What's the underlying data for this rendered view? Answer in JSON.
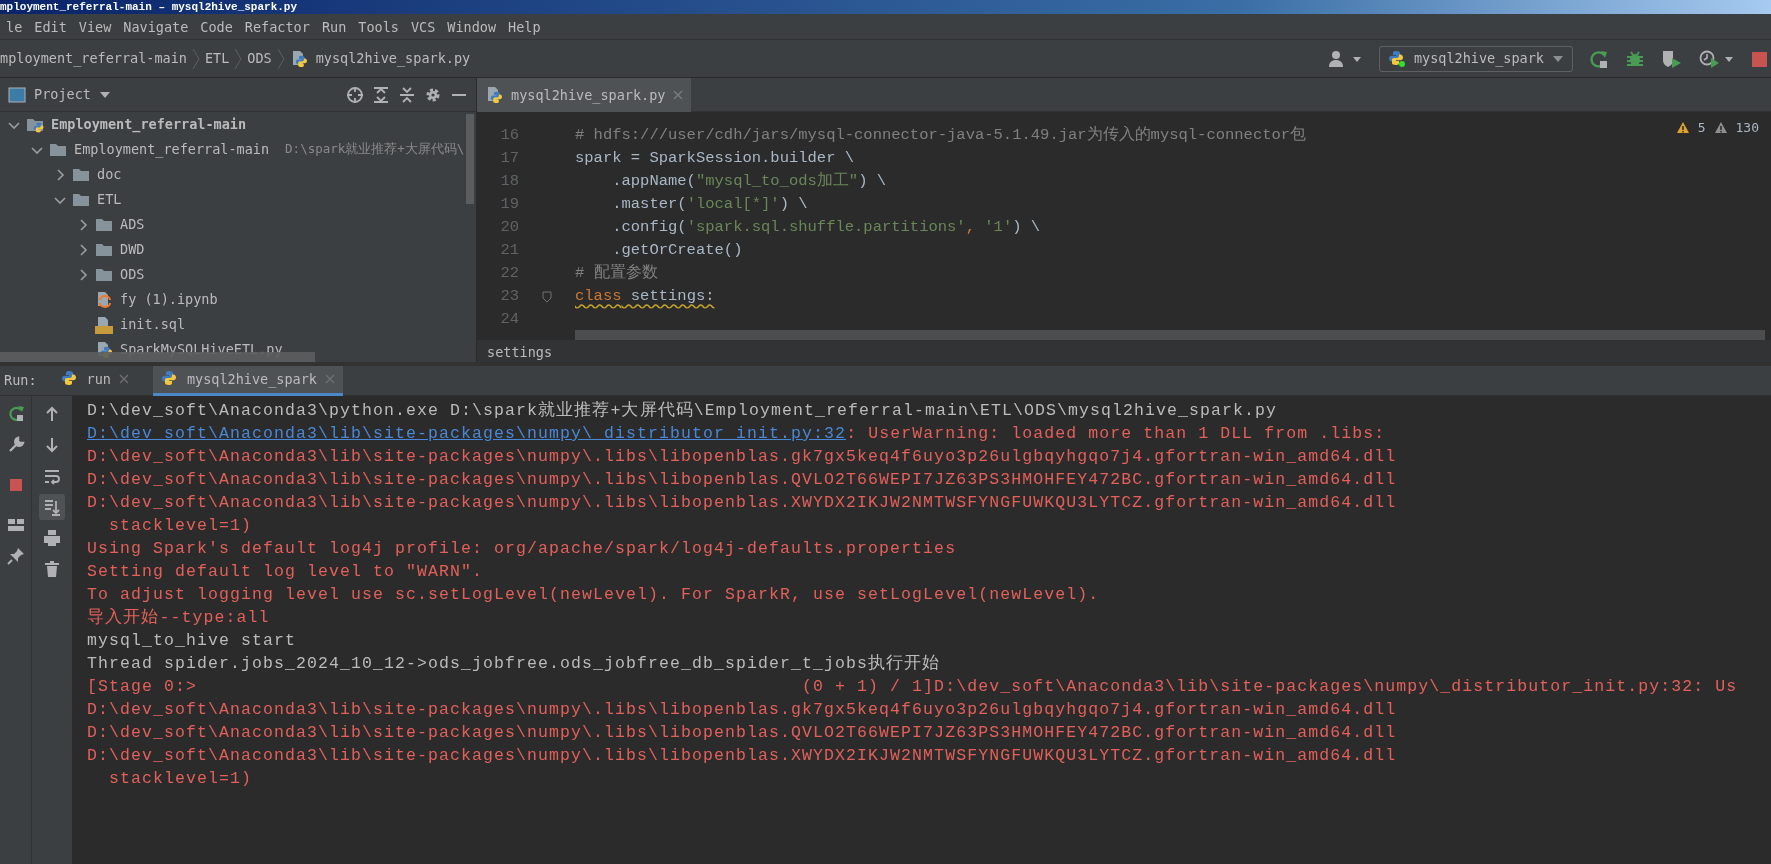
{
  "window": {
    "title": "mployment_referral-main – mysql2hive_spark.py"
  },
  "menu": [
    "le",
    "Edit",
    "View",
    "Navigate",
    "Code",
    "Refactor",
    "Run",
    "Tools",
    "VCS",
    "Window",
    "Help"
  ],
  "breadcrumbs": [
    {
      "label": "mployment_referral-main",
      "kind": "project"
    },
    {
      "label": "ETL",
      "kind": "folder"
    },
    {
      "label": "ODS",
      "kind": "folder"
    },
    {
      "label": "mysql2hive_spark.py",
      "kind": "python"
    }
  ],
  "run_config": {
    "label": "mysql2hive_spark"
  },
  "project_panel": {
    "title": "Project",
    "tree": [
      {
        "label": "Employment_referral-main",
        "kind": "project",
        "expanded": true,
        "children": [
          {
            "label": "Employment_referral-main",
            "kind": "folder",
            "expanded": true,
            "path": "D:\\spark就业推荐+大屏代码\\",
            "children": [
              {
                "label": "doc",
                "kind": "folder",
                "expanded": false
              },
              {
                "label": "ETL",
                "kind": "folder",
                "expanded": true,
                "children": [
                  {
                    "label": "ADS",
                    "kind": "folder",
                    "expanded": false
                  },
                  {
                    "label": "DWD",
                    "kind": "folder",
                    "expanded": false
                  },
                  {
                    "label": "ODS",
                    "kind": "folder",
                    "expanded": false
                  },
                  {
                    "label": "fy (1).ipynb",
                    "kind": "notebook"
                  },
                  {
                    "label": "init.sql",
                    "kind": "sql"
                  },
                  {
                    "label": "SparkMySQLHiveETL.py",
                    "kind": "python"
                  }
                ]
              }
            ]
          }
        ]
      }
    ]
  },
  "editor": {
    "tabs": [
      {
        "label": "mysql2hive_spark.py",
        "selected": true
      }
    ],
    "inspections": [
      {
        "kind": "warning",
        "count": "5"
      },
      {
        "kind": "weak_warning",
        "count": "130"
      }
    ],
    "lines": [
      {
        "number": "16",
        "tokens": [
          {
            "kind": "comment",
            "text": "# hdfs:///user/cdh/jars/mysql-connector-java-5.1.49.jar为传入的mysql-connector包"
          }
        ]
      },
      {
        "number": "17",
        "tokens": [
          {
            "kind": "plain",
            "text": "spark = SparkSession.builder \\"
          }
        ]
      },
      {
        "number": "18",
        "tokens": [
          {
            "kind": "plain",
            "text": "    .appName("
          },
          {
            "kind": "string",
            "text": "\"mysql_to_ods加工\""
          },
          {
            "kind": "plain",
            "text": ") \\"
          }
        ]
      },
      {
        "number": "19",
        "tokens": [
          {
            "kind": "plain",
            "text": "    .master("
          },
          {
            "kind": "string",
            "text": "'local[*]'"
          },
          {
            "kind": "plain",
            "text": ") \\"
          }
        ]
      },
      {
        "number": "20",
        "tokens": [
          {
            "kind": "plain",
            "text": "    .config("
          },
          {
            "kind": "string",
            "text": "'spark.sql.shuffle.partitions'"
          },
          {
            "kind": "keyword",
            "text": ", "
          },
          {
            "kind": "string",
            "text": "'1'"
          },
          {
            "kind": "plain",
            "text": ") \\"
          }
        ]
      },
      {
        "number": "21",
        "tokens": [
          {
            "kind": "plain",
            "text": "    .getOrCreate()"
          }
        ]
      },
      {
        "number": "22",
        "tokens": [
          {
            "kind": "comment",
            "text": "# 配置参数"
          }
        ]
      },
      {
        "number": "23",
        "flagged": true,
        "tokens": [
          {
            "kind": "keyword",
            "text": "class"
          },
          {
            "kind": "plain",
            "text": " settings:"
          }
        ]
      },
      {
        "number": "24"
      }
    ],
    "breadcrumb": "settings"
  },
  "run_panel": {
    "label": "Run:",
    "tabs": [
      {
        "label": "run",
        "selected": false
      },
      {
        "label": "mysql2hive_spark",
        "selected": true
      }
    ],
    "console": [
      {
        "kind": "plain",
        "text": "D:\\dev_soft\\Anaconda3\\python.exe D:\\spark就业推荐+大屏代码\\Employment_referral-main\\ETL\\ODS\\mysql2hive_spark.py"
      },
      {
        "kind": "link",
        "link": "D:\\dev_soft\\Anaconda3\\lib\\site-packages\\numpy\\_distributor_init.py:32",
        "text": ": UserWarning: loaded more than 1 DLL from .libs:"
      },
      {
        "kind": "error",
        "text": "D:\\dev_soft\\Anaconda3\\lib\\site-packages\\numpy\\.libs\\libopenblas.gk7gx5keq4f6uyo3p26ulgbqyhgqo7j4.gfortran-win_amd64.dll"
      },
      {
        "kind": "error",
        "text": "D:\\dev_soft\\Anaconda3\\lib\\site-packages\\numpy\\.libs\\libopenblas.QVLO2T66WEPI7JZ63PS3HMOHFEY472BC.gfortran-win_amd64.dll"
      },
      {
        "kind": "error",
        "text": "D:\\dev_soft\\Anaconda3\\lib\\site-packages\\numpy\\.libs\\libopenblas.XWYDX2IKJW2NMTWSFYNGFUWKQU3LYTCZ.gfortran-win_amd64.dll"
      },
      {
        "kind": "error",
        "text": "  stacklevel=1)"
      },
      {
        "kind": "error",
        "text": "Using Spark's default log4j profile: org/apache/spark/log4j-defaults.properties"
      },
      {
        "kind": "error",
        "text": "Setting default log level to \"WARN\"."
      },
      {
        "kind": "error",
        "text": "To adjust logging level use sc.setLogLevel(newLevel). For SparkR, use setLogLevel(newLevel)."
      },
      {
        "kind": "error",
        "text": "导入开始--type:all"
      },
      {
        "kind": "plain",
        "text": "mysql_to_hive start"
      },
      {
        "kind": "plain",
        "text": "Thread spider.jobs_2024_10_12->ods_jobfree.ods_jobfree_db_spider_t_jobs执行开始"
      },
      {
        "kind": "error",
        "text": "[Stage 0:>                                                       (0 + 1) / 1]D:\\dev_soft\\Anaconda3\\lib\\site-packages\\numpy\\_distributor_init.py:32: Us"
      },
      {
        "kind": "error",
        "text": "D:\\dev_soft\\Anaconda3\\lib\\site-packages\\numpy\\.libs\\libopenblas.gk7gx5keq4f6uyo3p26ulgbqyhgqo7j4.gfortran-win_amd64.dll"
      },
      {
        "kind": "error",
        "text": "D:\\dev_soft\\Anaconda3\\lib\\site-packages\\numpy\\.libs\\libopenblas.QVLO2T66WEPI7JZ63PS3HMOHFEY472BC.gfortran-win_amd64.dll"
      },
      {
        "kind": "error",
        "text": "D:\\dev_soft\\Anaconda3\\lib\\site-packages\\numpy\\.libs\\libopenblas.XWYDX2IKJW2NMTWSFYNGFUWKQU3LYTCZ.gfortran-win_amd64.dll"
      },
      {
        "kind": "error",
        "text": "  stacklevel=1)"
      }
    ]
  }
}
